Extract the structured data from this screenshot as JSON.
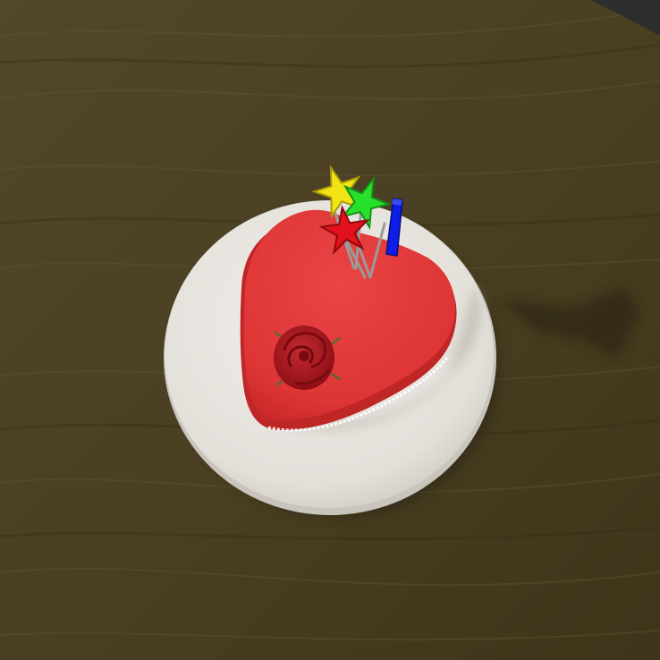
{
  "scene": {
    "subject": "heart-cake",
    "colors": {
      "table": "#4a3f22",
      "table_light": "#5e5330",
      "table_dark": "#352c15",
      "plate": "#e7e5e0",
      "plate_shadow": "#b9b6ae",
      "cake": "#e03a3a",
      "cake_side": "#c22a2a",
      "rose": "#a8161e",
      "stem": "#556b2f",
      "star_yellow": "#f2e414",
      "star_green": "#29e02b",
      "star_red": "#e2111b",
      "candle_blue": "#0c1ee8",
      "stick": "#9a9a9a"
    },
    "icons": [
      "yellow-star-topper-icon",
      "green-star-topper-icon",
      "red-star-topper-icon",
      "blue-candle-icon",
      "rose-icon"
    ]
  }
}
